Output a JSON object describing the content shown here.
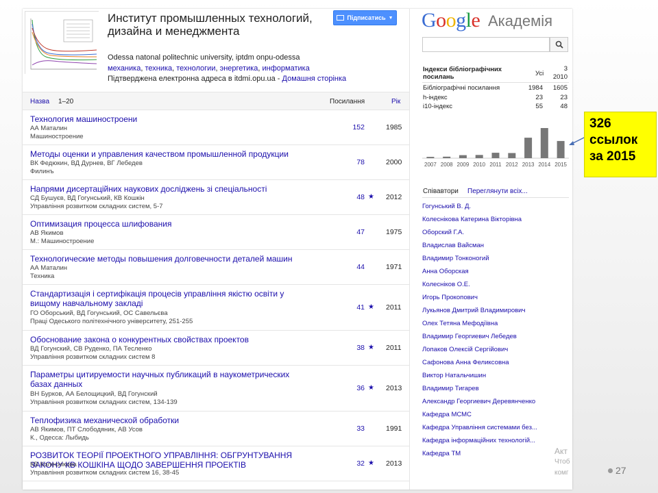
{
  "profile": {
    "name": "Институт промышленных технологий, дизайна и менеджмента",
    "follow_label": "Підписатись",
    "affiliation": "Odessa natonal politechnic university, iptdm onpu-odessa",
    "interests": [
      "механика",
      "техника",
      "технологии",
      "энергетика",
      "информатика"
    ],
    "email_text": "Підтверджена електронна адреса в itdmi.opu.ua",
    "homepage_sep": " - ",
    "homepage_label": "Домашня сторінка"
  },
  "table": {
    "title_col": "Назва",
    "range": "1–20",
    "cites_col": "Посилання",
    "year_col": "Рік",
    "rows": [
      {
        "title": "Технология машиностроени",
        "authors": "АА Маталин",
        "venue": "Машиностроение",
        "cites": "152",
        "star": false,
        "year": "1985"
      },
      {
        "title": "Методы оценки и управления качеством промышленной продукции",
        "authors": "ВК Федюкин, ВД Дурнев, ВГ Лебедев",
        "venue": "Филинъ",
        "cites": "78",
        "star": false,
        "year": "2000"
      },
      {
        "title": "Напрями дисертаційних наукових досліджень зі спеціальності",
        "authors": "СД Бушуєв, ВД Гогунський, КВ Кошкін",
        "venue": "Управління розвитком складних систем, 5-7",
        "cites": "48",
        "star": true,
        "year": "2012"
      },
      {
        "title": "Оптимизация процесса шлифования",
        "authors": "АВ Якимов",
        "venue": "М.: Машиностроение",
        "cites": "47",
        "star": false,
        "year": "1975"
      },
      {
        "title": "Технологические методы повышения долговечности деталей машин",
        "authors": "АА Маталин",
        "venue": "Техника",
        "cites": "44",
        "star": false,
        "year": "1971"
      },
      {
        "title": "Стандартизація і сертифікація процесів управління якістю освіти у вищому навчальному закладі",
        "authors": "ГО Оборський, ВД Гогунський, ОС Савельєва",
        "venue": "Праці Одеського політехнічного університету, 251-255",
        "cites": "41",
        "star": true,
        "year": "2011"
      },
      {
        "title": "Обоснование закона о конкурентных свойствах проектов",
        "authors": "ВД Гогунский, СВ Руденко, ПА Тесленко",
        "venue": "Управління розвитком складних систем 8",
        "cites": "38",
        "star": true,
        "year": "2011"
      },
      {
        "title": "Параметры цитируемости научных публикаций в наукометрических базах данных",
        "authors": "ВН Бурков, АА Белощицкий, ВД Гогунский",
        "venue": "Управління розвитком складних систем, 134-139",
        "cites": "36",
        "star": true,
        "year": "2013"
      },
      {
        "title": "Теплофизика механической обработки",
        "authors": "АВ Якимов, ПТ Слободяник, АВ Усов",
        "venue": "К., Одесса: Лыбидь",
        "cites": "33",
        "star": false,
        "year": "1991"
      },
      {
        "title": "РОЗВИТОК ТЕОРІЇ ПРОЕКТНОГО УПРАВЛІННЯ: ОБГРУНТУВАННЯ ЗАКОНУ КВ КОШКІНА ЩОДО ЗАВЕРШЕННЯ ПРОЕКТІВ",
        "authors": "КВ Колеснікова",
        "venue": "Управління розвитком складних систем 16, 38-45",
        "cites": "32",
        "star": true,
        "year": "2013"
      }
    ]
  },
  "brand": {
    "word": "Google",
    "suffix": "Академія"
  },
  "metrics": {
    "title": "Індекси бібліографічних посилань",
    "all_label": "Усі",
    "since_label_1": "3",
    "since_label_2": "2010",
    "rows": [
      {
        "label": "Бібліографічні посилання",
        "all": "1984",
        "since": "1605"
      },
      {
        "label": "h-індекс",
        "all": "23",
        "since": "23"
      },
      {
        "label": "i10-індекс",
        "all": "55",
        "since": "48"
      }
    ]
  },
  "chart_data": {
    "type": "bar",
    "categories": [
      "2007",
      "2008",
      "2009",
      "2010",
      "2011",
      "2012",
      "2013",
      "2014",
      "2015"
    ],
    "values": [
      12,
      14,
      28,
      30,
      50,
      48,
      190,
      280,
      160
    ]
  },
  "coauthors": {
    "header": "Співавтори",
    "view_all": "Переглянути всіх...",
    "items": [
      "Гогунський В. Д.",
      "Колеснікова Катерина Вікторівна",
      "Оборский Г.А.",
      "Владислав Вайсман",
      "Владимир Тонконогий",
      "Анна Оборская",
      "Колесніков О.Е.",
      "Игорь Прокопович",
      "Лукьянов Дмитрий Владимирович",
      "Олех Тетяна Мефодіївна",
      "Владимир Георгиевич Лебедев",
      "Лопаков Олексій Сергійович",
      "Сафонова Анна Феликсовна",
      "Виктор Натальчишин",
      "Владимир Тигарев",
      "Александр Георгиевич Деревянченко",
      "Кафедра МСМС",
      "Кафедра Управління системами без...",
      "Кафедра інформаційних технологій...",
      "Кафедра ТМ"
    ]
  },
  "watermark": {
    "line1": "Акт",
    "line2": "Чтоб",
    "line3": "комг"
  },
  "callout": {
    "line1": "326",
    "line2": "ссылок",
    "line3": "за 2015"
  },
  "slide": {
    "page_number": "27"
  },
  "colors": {
    "accent": "#4d90fe",
    "link": "#1a0dab",
    "bar": "#777777",
    "callout": "#ffff00"
  }
}
